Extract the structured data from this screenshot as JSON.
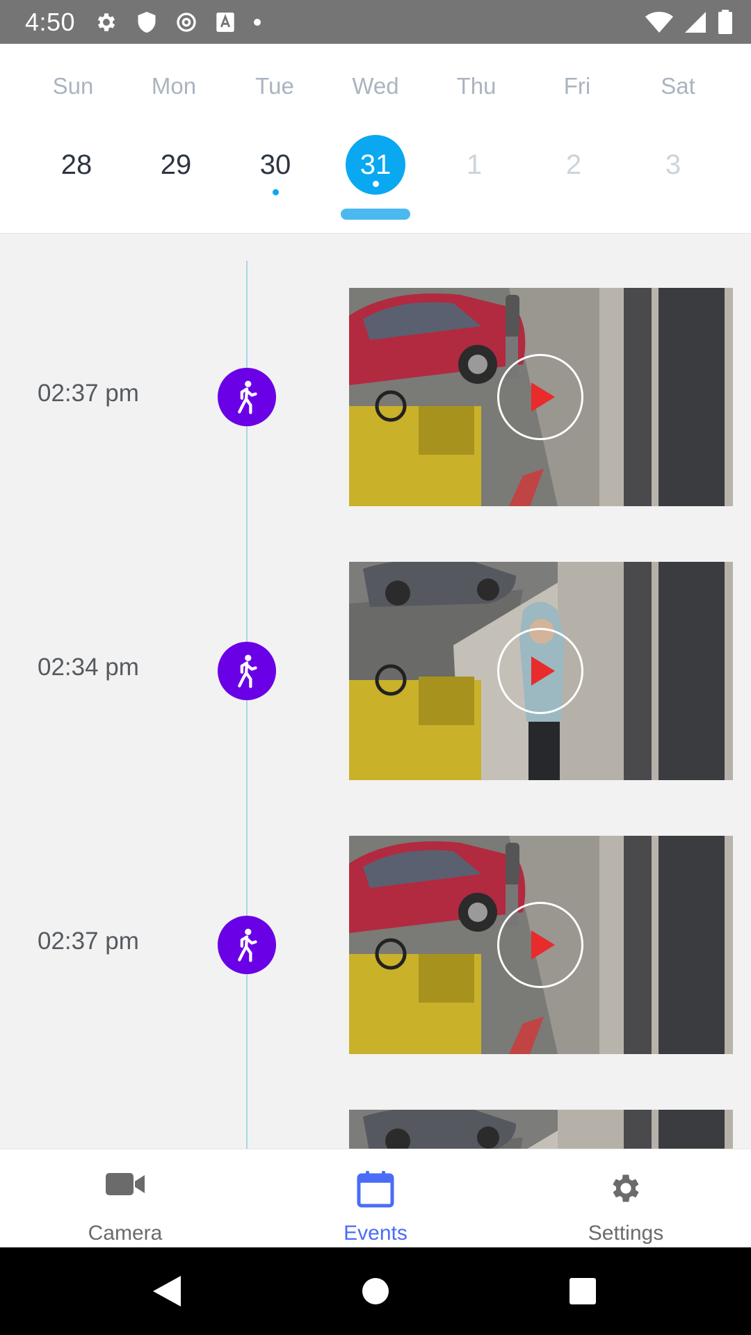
{
  "status_bar": {
    "time": "4:50",
    "left_icons": [
      "gear-icon",
      "shield-icon",
      "at-sign-icon",
      "text-a-icon",
      "dot-icon"
    ],
    "right_icons": [
      "wifi-icon",
      "signal-icon",
      "battery-icon"
    ]
  },
  "calendar": {
    "weekdays": [
      "Sun",
      "Mon",
      "Tue",
      "Wed",
      "Thu",
      "Fri",
      "Sat"
    ],
    "dates": [
      {
        "label": "28",
        "state": "past",
        "has_events": false
      },
      {
        "label": "29",
        "state": "past",
        "has_events": false
      },
      {
        "label": "30",
        "state": "past",
        "has_events": true
      },
      {
        "label": "31",
        "state": "selected",
        "has_events": true
      },
      {
        "label": "1",
        "state": "future",
        "has_events": false
      },
      {
        "label": "2",
        "state": "future",
        "has_events": false
      },
      {
        "label": "3",
        "state": "future",
        "has_events": false
      }
    ],
    "selected_color": "#0aa8f0"
  },
  "events": [
    {
      "time": "02:37 pm",
      "type": "person-walking-icon",
      "scene": "red-car"
    },
    {
      "time": "02:34 pm",
      "type": "person-walking-icon",
      "scene": "gray-car-person"
    },
    {
      "time": "02:37 pm",
      "type": "person-walking-icon",
      "scene": "red-car"
    },
    {
      "time": "",
      "type": "",
      "scene": "gray-car-person"
    }
  ],
  "event_badge_color": "#6a00e6",
  "bottom_nav": {
    "items": [
      {
        "label": "Camera",
        "icon": "video-camera-icon",
        "active": false
      },
      {
        "label": "Events",
        "icon": "calendar-icon",
        "active": true
      },
      {
        "label": "Settings",
        "icon": "gear-icon",
        "active": false
      }
    ],
    "active_color": "#4a6cf7"
  },
  "system_nav": [
    "back-icon",
    "home-icon",
    "recents-icon"
  ]
}
